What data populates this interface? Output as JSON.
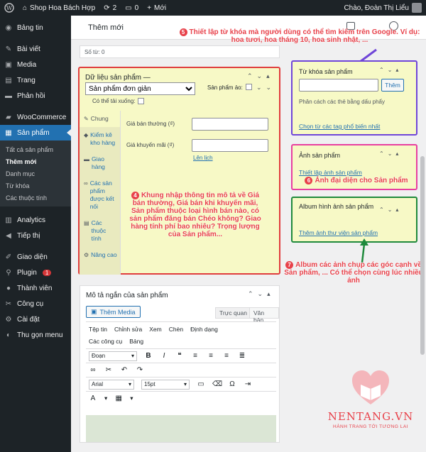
{
  "adminbar": {
    "site_name": "Shop Hoa Bách Hợp",
    "updates_count": "2",
    "comments_count": "0",
    "new_label": "Mới",
    "greeting": "Chào, Đoàn Thị Liểu"
  },
  "sidebar": {
    "items": [
      {
        "label": "Bảng tin",
        "icon": "dashboard-icon"
      },
      {
        "label": "Bài viết",
        "icon": "pin-icon"
      },
      {
        "label": "Media",
        "icon": "media-icon"
      },
      {
        "label": "Trang",
        "icon": "page-icon"
      },
      {
        "label": "Phản hồi",
        "icon": "comment-icon"
      },
      {
        "label": "WooCommerce",
        "icon": "woo-icon"
      },
      {
        "label": "Sản phẩm",
        "icon": "product-icon"
      }
    ],
    "submenu": [
      "Tất cả sản phẩm",
      "Thêm mới",
      "Danh mục",
      "Từ khóa",
      "Các thuộc tính"
    ],
    "items2": [
      {
        "label": "Analytics",
        "icon": "analytics-icon"
      },
      {
        "label": "Tiếp thị",
        "icon": "megaphone-icon"
      },
      {
        "label": "Giao diện",
        "icon": "appearance-icon"
      },
      {
        "label": "Plugin",
        "icon": "plugin-icon",
        "badge": "1"
      },
      {
        "label": "Thành viên",
        "icon": "users-icon"
      },
      {
        "label": "Công cụ",
        "icon": "tools-icon"
      },
      {
        "label": "Cài đặt",
        "icon": "settings-icon"
      },
      {
        "label": "Thu gọn menu",
        "icon": "collapse-icon"
      }
    ]
  },
  "page": {
    "new_title": "Thêm mới",
    "word_count": "Số từ: 0"
  },
  "product_data": {
    "title": "Dữ liệu sản phẩm —",
    "type_selected": "Sản phẩm đơn giản",
    "virtual_label": "Sản phẩm ảo:",
    "downloadable_label": "Có thể tải xuống:",
    "tabs": [
      "Chung",
      "Kiểm kê kho hàng",
      "Giao hàng",
      "Các sản phẩm được kết nối",
      "Các thuộc tính",
      "Nâng cao"
    ],
    "regular_price_label": "Giá bán thường (₫)",
    "sale_price_label": "Giá khuyến mãi (₫)",
    "schedule_link": "Lên lịch"
  },
  "short_desc": {
    "title": "Mô tả ngắn của sản phẩm",
    "add_media": "Thêm Media",
    "tab_visual": "Trực quan",
    "tab_text": "Văn bản",
    "menu1": [
      "Tệp tin",
      "Chỉnh sửa",
      "Xem",
      "Chèn",
      "Định dạng"
    ],
    "menu2": [
      "Các công cụ",
      "Bảng"
    ],
    "format_select": "Đoạn",
    "font_select": "Arial",
    "size_select": "15pt"
  },
  "tags_box": {
    "title": "Từ khóa sản phẩm",
    "add_button": "Thêm",
    "hint": "Phân cách các thẻ bằng dấu phẩy",
    "popular_link": "Chọn từ các tag phổ biến nhất"
  },
  "image_box": {
    "title": "Ảnh sản phẩm",
    "link": "Thiết lập ảnh sản phẩm"
  },
  "gallery_box": {
    "title": "Album hình ảnh sản phẩm",
    "link": "Thêm ảnh thư viện sản phẩm"
  },
  "annotations": {
    "a4": "Khung nhập thông tin mô tả về Giá bán thường, Giá bán khi khuyến mãi, Sản phẩm thuộc loại hình bán nào, có sản phẩm đăng bán Chéo không? Giao hàng tính phí bao nhiêu? Trọng lượng của Sản phẩm...",
    "a5": "Thiết lập từ khóa mà người dùng có thể tìm kiếm trên Google. Ví dụ: hoa tươi, hoa tháng 10, hoa sinh nhật, ...",
    "a6": "Ảnh đại diện cho Sản phẩm",
    "a7": "Album các ảnh chụp các góc cạnh về Sản phẩm, ... Có thể chọn cùng lúc nhiều ảnh",
    "n4": "4",
    "n5": "5",
    "n6": "6",
    "n7": "7"
  },
  "brand": {
    "name": "NENTANG.VN",
    "slogan": "HÀNH TRANG TỚI TƯƠNG LAI"
  },
  "colors": {
    "annotation": "#e8414a",
    "highlight": "#f7f9c6",
    "box_red": "#e03d3d",
    "box_purple": "#6f45d8",
    "box_pink": "#e83fa0",
    "box_green": "#1f8a3c"
  }
}
